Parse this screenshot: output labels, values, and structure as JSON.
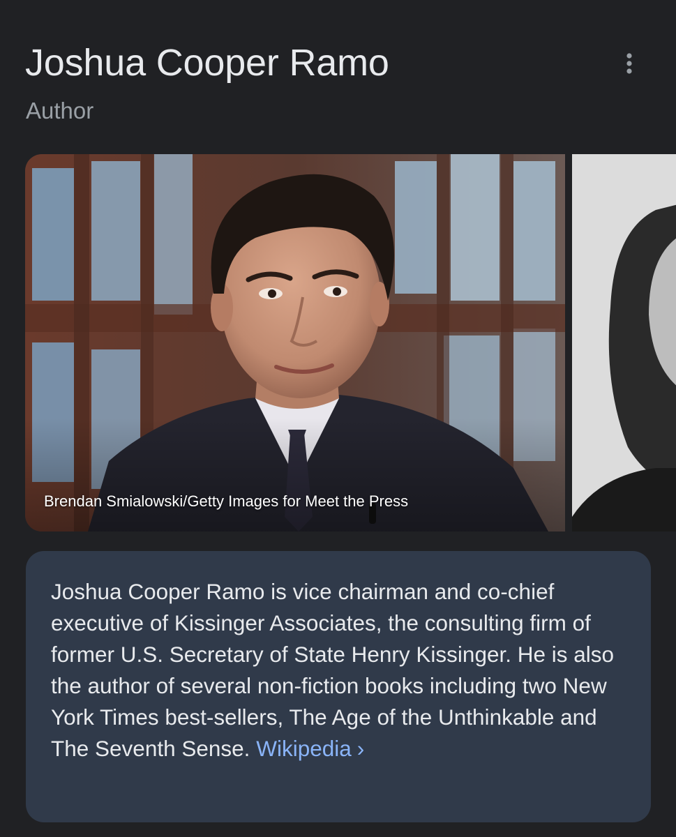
{
  "entity": {
    "title": "Joshua Cooper Ramo",
    "subtitle": "Author"
  },
  "header": {
    "more_icon": "more-vert-icon"
  },
  "images": [
    {
      "caption": "Brendan Smialowski/Getty Images for Meet the Press",
      "kind": "color portrait"
    },
    {
      "kind": "black-and-white portrait"
    }
  ],
  "description": {
    "text": "Joshua Cooper Ramo is vice chairman and co-chief executive of Kissinger Associates, the consulting firm of former U.S. Secretary of State Henry Kissinger. He is also the author of several non-fiction books including two New York Times best-sellers, The Age of the Unthinkable and The Seventh Sense.",
    "source_label": "Wikipedia",
    "chevron": "›"
  },
  "colors": {
    "background": "#202124",
    "card": "#303a4a",
    "link": "#8ab4f8",
    "text": "#e8eaed",
    "muted": "#9aa0a6"
  }
}
